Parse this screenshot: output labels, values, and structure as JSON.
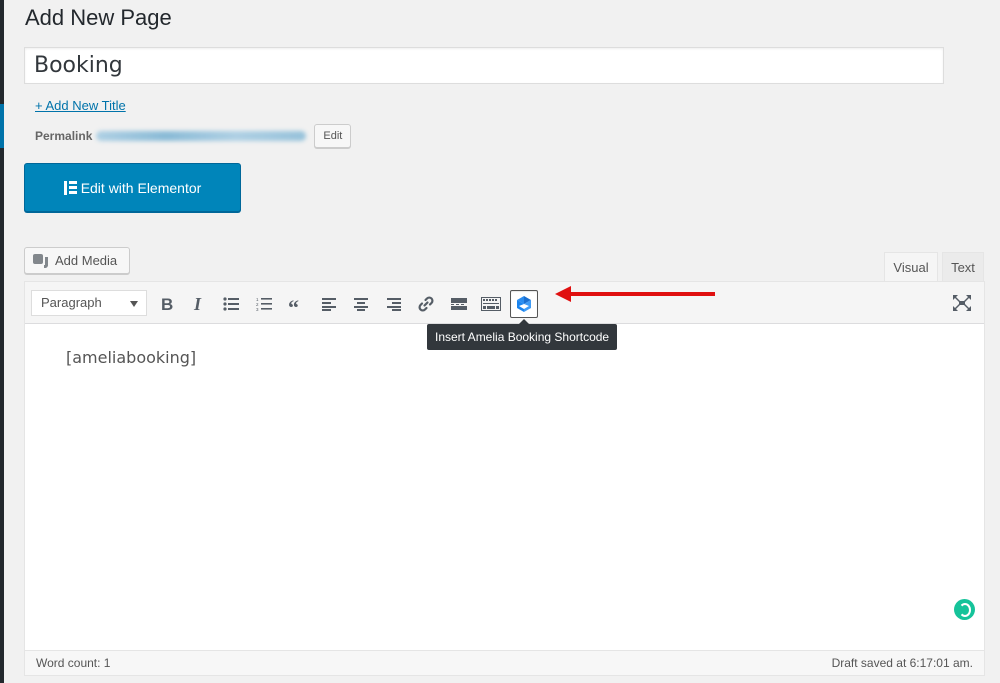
{
  "page": {
    "title": "Add New Page"
  },
  "post": {
    "title_value": "Booking",
    "add_title_link": "+ Add New Title",
    "permalink_label": "Permalink",
    "permalink_edit": "Edit"
  },
  "elementor": {
    "button_label": "Edit with Elementor"
  },
  "media": {
    "add_media_label": "Add Media"
  },
  "editor": {
    "tabs": [
      {
        "label": "Visual",
        "active": true
      },
      {
        "label": "Text",
        "active": false
      }
    ],
    "format_select": "Paragraph",
    "toolbar": [
      {
        "name": "bold-icon",
        "label": "Bold"
      },
      {
        "name": "italic-icon",
        "label": "Italic"
      },
      {
        "name": "bulleted-list-icon",
        "label": "Bulleted list"
      },
      {
        "name": "numbered-list-icon",
        "label": "Numbered list"
      },
      {
        "name": "blockquote-icon",
        "label": "Blockquote"
      },
      {
        "name": "align-left-icon",
        "label": "Align left"
      },
      {
        "name": "align-center-icon",
        "label": "Align center"
      },
      {
        "name": "align-right-icon",
        "label": "Align right"
      },
      {
        "name": "link-icon",
        "label": "Insert/edit link"
      },
      {
        "name": "read-more-icon",
        "label": "Insert Read More tag"
      },
      {
        "name": "toolbar-toggle-icon",
        "label": "Toolbar Toggle"
      },
      {
        "name": "amelia-icon",
        "label": "Insert Amelia Booking Shortcode"
      }
    ],
    "tooltip": "Insert Amelia Booking Shortcode",
    "content": "[ameliabooking]",
    "word_count": "Word count: 1",
    "draft_status": "Draft saved at 6:17:01 am."
  },
  "colors": {
    "primary": "#0085ba",
    "link": "#0073aa",
    "annotation_arrow": "#e01010",
    "amelia_blue": "#1a84ee",
    "grammarly": "#15c39a"
  }
}
